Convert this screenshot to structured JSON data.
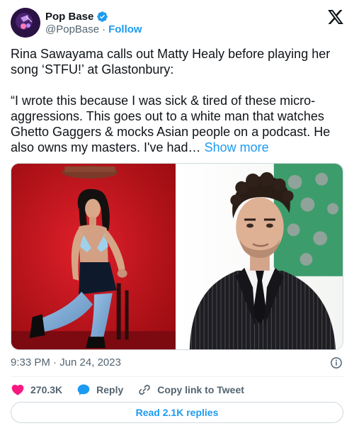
{
  "author": {
    "display_name": "Pop Base",
    "handle": "@PopBase",
    "separator": "·",
    "follow_label": "Follow",
    "verified_color": "#1d9bf0",
    "avatar_icon": "pop-base-logo-icon"
  },
  "platform_icon": "x-logo-icon",
  "tweet": {
    "text_line1": "Rina Sawayama calls out Matty Healy before playing her song ‘STFU!’ at Glastonbury:",
    "text_line2": "“I wrote this because I was sick & tired of these micro-aggressions. This goes out to a white man that watches Ghetto Gaggers & mocks Asian people on a podcast. He also owns my masters. I've had…",
    "show_more_label": "Show more"
  },
  "media": {
    "left_photo": "woman-posing-red-backdrop",
    "right_photo": "man-pinstripe-suit-portrait"
  },
  "meta": {
    "timestamp": "9:33 PM · Jun 24, 2023",
    "info_icon": "info-icon"
  },
  "actions": {
    "likes_count": "270.3K",
    "reply_label": "Reply",
    "copy_link_label": "Copy link to Tweet",
    "like_color": "#f91880",
    "reply_color": "#1d9bf0"
  },
  "read_replies_label": "Read 2.1K replies",
  "colors": {
    "text": "#0f1419",
    "secondary": "#536471",
    "accent": "#1d9bf0",
    "border": "#cfd9de"
  }
}
